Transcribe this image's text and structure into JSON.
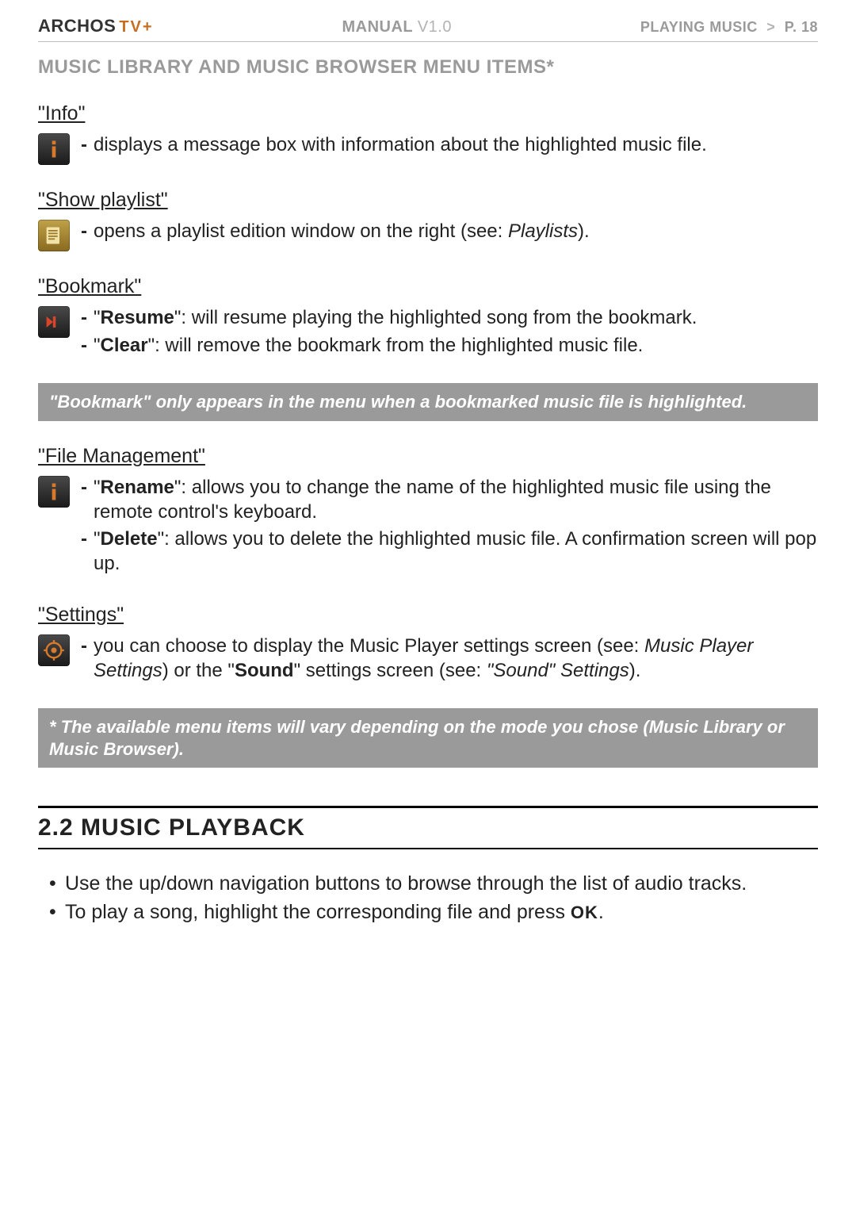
{
  "header": {
    "brand": "ARCHOS",
    "brand_suffix": "TV+",
    "manual_label": "MANUAL",
    "manual_version": "V1.0",
    "crumb_section": "PLAYING MUSIC",
    "crumb_sep": ">",
    "crumb_page": "P. 18"
  },
  "section_heading": "MUSIC LIBRARY AND MUSIC BROWSER MENU ITEMS*",
  "items": {
    "info": {
      "title": "\"Info\"",
      "line1": "displays a message box with information about the highlighted music file."
    },
    "playlist": {
      "title": "\"Show playlist\"",
      "line1_a": "opens a playlist edition window on the right (see: ",
      "line1_em": "Playlists",
      "line1_b": ")."
    },
    "bookmark": {
      "title": "\"Bookmark\"",
      "resume_label": "Resume",
      "resume_text": "\": will resume playing the highlighted song from the bookmark.",
      "clear_label": "Clear",
      "clear_text": "\": will remove the bookmark from the highlighted music file."
    },
    "bookmark_note": "\"Bookmark\" only appears in the menu when a bookmarked music file is highlighted.",
    "filemgmt": {
      "title": "\"File Management\"",
      "rename_label": "Rename",
      "rename_text": "\": allows you to change the name of the highlighted music file using the remote control's keyboard.",
      "delete_label": "Delete",
      "delete_text": "\": allows you to delete the highlighted music file. A confirmation screen will pop up."
    },
    "settings": {
      "title": "\"Settings\"",
      "text_a": "you can choose to display the Music Player settings screen (see: ",
      "em1": "Music Player Settings",
      "text_b": ") or the \"",
      "bold": "Sound",
      "text_c": "\" settings screen (see: ",
      "em2": "\"Sound\" Settings",
      "text_d": ")."
    },
    "footnote": "* The available menu items will vary depending on the mode you chose (Music Library or Music Browser)."
  },
  "chapter": {
    "title": "2.2 MUSIC PLAYBACK",
    "b1": "Use the up/down navigation buttons to browse through the list of audio tracks.",
    "b2_a": "To play a song, highlight the corresponding file and press ",
    "b2_ok": "OK",
    "b2_b": "."
  }
}
